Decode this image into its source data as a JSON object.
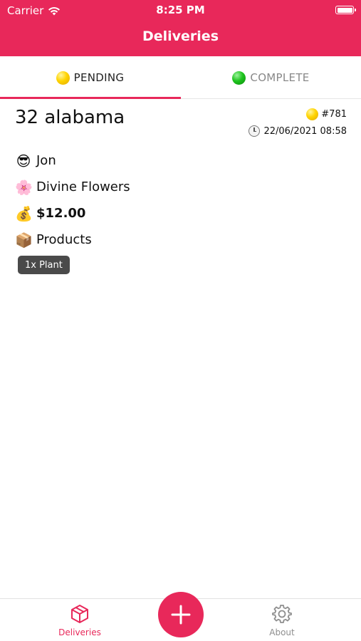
{
  "status_bar": {
    "carrier": "Carrier",
    "time": "8:25 PM"
  },
  "nav": {
    "title": "Deliveries"
  },
  "tabs": [
    {
      "label": "PENDING",
      "icon": "yellow-dot-icon",
      "active": true
    },
    {
      "label": "COMPLETE",
      "icon": "green-dot-icon",
      "active": false
    }
  ],
  "delivery": {
    "address": "32 alabama",
    "order_number": "#781",
    "datetime": "22/06/2021 08:58",
    "courier": {
      "icon": "😎",
      "name": "Jon"
    },
    "store": {
      "icon": "🌸",
      "name": "Divine Flowers"
    },
    "price": {
      "icon": "💰",
      "value": "$12.00"
    },
    "products": {
      "icon": "📦",
      "label": "Products",
      "items": [
        "1x Plant"
      ]
    }
  },
  "tabbar": {
    "items": [
      {
        "label": "Deliveries",
        "icon": "box-icon",
        "active": true
      },
      {
        "label": "About",
        "icon": "gear-icon",
        "active": false
      }
    ],
    "fab_icon": "plus-icon"
  },
  "colors": {
    "accent": "#e8285a",
    "chip": "#4a4a4a"
  }
}
